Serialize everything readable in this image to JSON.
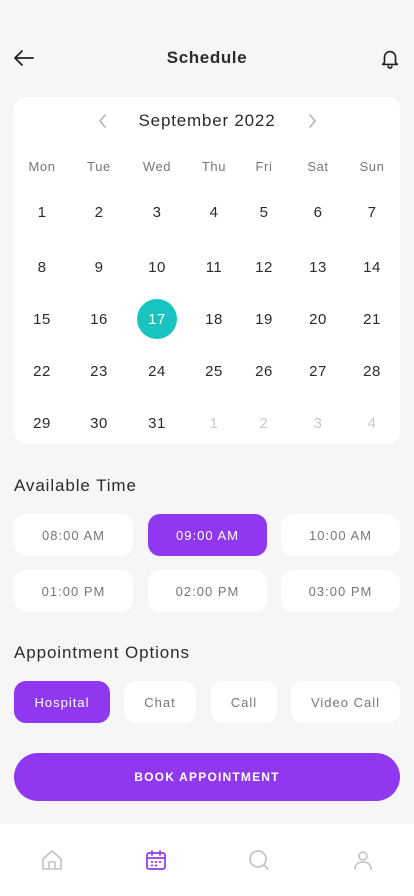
{
  "header": {
    "title": "Schedule"
  },
  "calendar": {
    "month": "September 2022",
    "weekdays": [
      "Mon",
      "Tue",
      "Wed",
      "Thu",
      "Fri",
      "Sat",
      "Sun"
    ],
    "weeks": [
      [
        "1",
        "2",
        "3",
        "4",
        "5",
        "6",
        "7"
      ],
      [
        "8",
        "9",
        "10",
        "11",
        "12",
        "13",
        "14"
      ],
      [
        "15",
        "16",
        "17",
        "18",
        "19",
        "20",
        "21"
      ],
      [
        "22",
        "23",
        "24",
        "25",
        "26",
        "27",
        "28"
      ],
      [
        "29",
        "30",
        "31",
        "1",
        "2",
        "3",
        "4"
      ]
    ],
    "selected_day": "17"
  },
  "available_time": {
    "title": "Available Time",
    "slots": [
      "08:00 AM",
      "09:00 AM",
      "10:00 AM",
      "01:00 PM",
      "02:00 PM",
      "03:00 PM"
    ],
    "selected": "09:00 AM"
  },
  "appointment_options": {
    "title": "Appointment Options",
    "options": [
      "Hospital",
      "Chat",
      "Call",
      "Video Call"
    ],
    "selected": "Hospital"
  },
  "book_button": {
    "label": "BOOK APPOINTMENT"
  },
  "tab_bar": {
    "tabs": [
      "home-icon",
      "calendar-icon",
      "search-icon",
      "profile-icon"
    ],
    "active": "calendar-icon"
  },
  "colors": {
    "accent": "#9038f0",
    "selected_day": "#18c3c0",
    "background": "#f6f6f7"
  }
}
